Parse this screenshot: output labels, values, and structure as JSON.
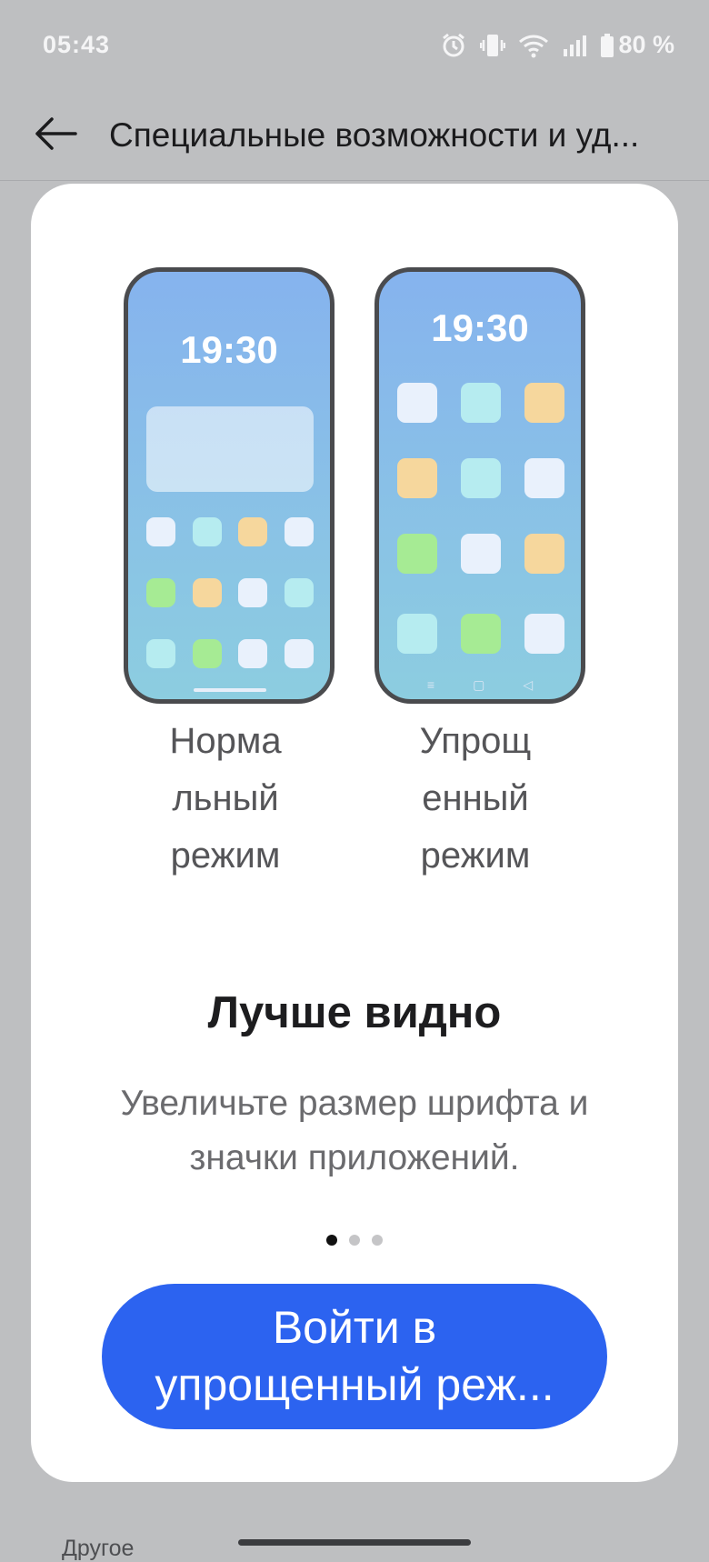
{
  "status_bar": {
    "time": "05:43",
    "battery": "80 %",
    "icons": [
      "alarm-icon",
      "vibrate-icon",
      "wifi-icon",
      "signal-icon",
      "battery-icon"
    ]
  },
  "app_bar": {
    "back_icon": "arrow-left-icon",
    "title": "Специальные возможности и уд..."
  },
  "preview": {
    "normal_clock": "19:30",
    "simple_clock": "19:30",
    "normal_label": "Норма\nльный\nрежим",
    "simple_label": "Упрощ\nенный\nрежим",
    "nav_glyphs": [
      "≡",
      "▢",
      "◁"
    ]
  },
  "content": {
    "headline": "Лучше видно",
    "description": "Увеличьте размер шрифта и значки приложений.",
    "page_count": 3,
    "active_page": 1
  },
  "button": {
    "line1": "Войти в",
    "line2": "упрощенный реж..."
  },
  "footer": {
    "section_label": "Другое"
  },
  "colors": {
    "background": "#bebfc1",
    "card": "#ffffff",
    "accent": "#2c63f0",
    "tile_white": "#e9f1fc",
    "tile_cyan": "#b6ecf0",
    "tile_orange": "#f6d79d",
    "tile_green": "#a6eb94"
  }
}
